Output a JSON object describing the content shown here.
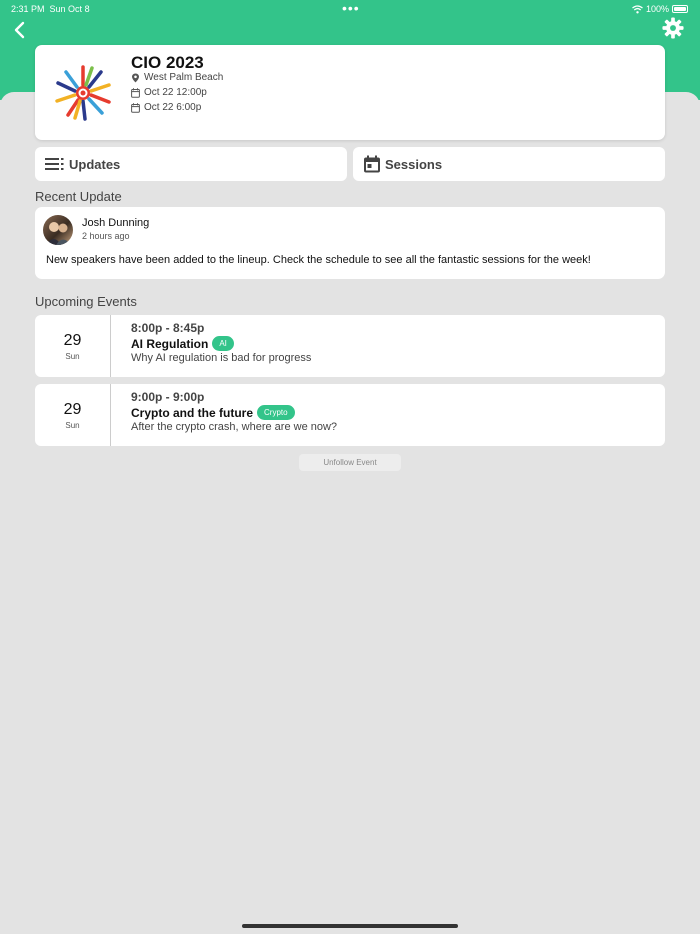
{
  "status_bar": {
    "time": "2:31 PM",
    "date": "Sun Oct 8",
    "battery": "100%"
  },
  "event": {
    "title": "CIO 2023",
    "location": "West Palm Beach",
    "start": "Oct 22 12:00p",
    "end": "Oct 22 6:00p"
  },
  "tabs": {
    "updates": "Updates",
    "sessions": "Sessions"
  },
  "recent_update": {
    "section_title": "Recent Update",
    "author": "Josh Dunning",
    "time_ago": "2 hours ago",
    "text": "New speakers have been added to the lineup. Check the schedule to see all the fantastic sessions for the week!"
  },
  "upcoming": {
    "section_title": "Upcoming Events",
    "events": [
      {
        "day": "29",
        "dow": "Sun",
        "time": "8:00p - 8:45p",
        "name": "AI Regulation",
        "tag": "AI",
        "description": "Why AI regulation is bad for progress"
      },
      {
        "day": "29",
        "dow": "Sun",
        "time": "9:00p - 9:00p",
        "name": "Crypto and the future",
        "tag": "Crypto",
        "description": "After the crypto crash, where are we now?"
      }
    ]
  },
  "unfollow_label": "Unfollow Event",
  "colors": {
    "accent": "#33c48a",
    "background": "#e3e3e3"
  },
  "icons": [
    "back-icon",
    "gear-icon",
    "location-pin-icon",
    "calendar-icon",
    "list-icon",
    "wifi-icon",
    "battery-icon"
  ]
}
